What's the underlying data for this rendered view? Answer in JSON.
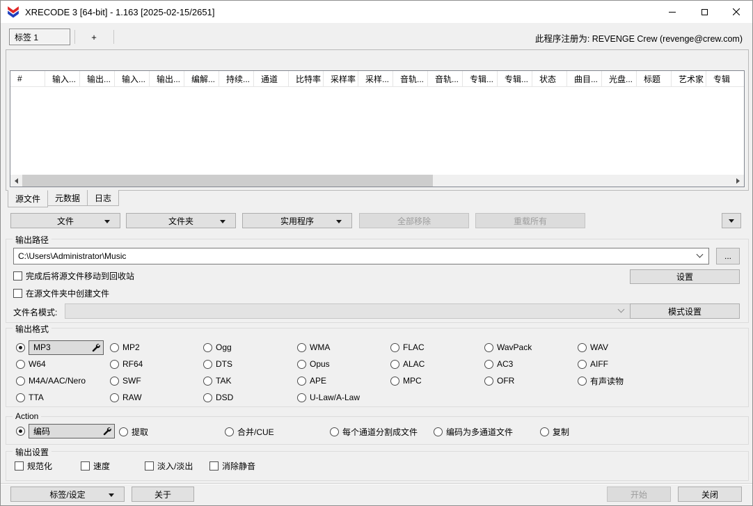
{
  "window": {
    "title": "XRECODE 3 [64-bit] - 1.163 [2025-02-15/2651]",
    "registration": "此程序注册为: REVENGE Crew (revenge@crew.com)"
  },
  "tab_strip": {
    "active_tab": "标签 1",
    "add_tab": "+"
  },
  "file_table": {
    "columns": [
      "#",
      "输入...",
      "输出...",
      "输入...",
      "输出...",
      "编解...",
      "持续...",
      "通道",
      "比特率",
      "采样率",
      "采样...",
      "音轨...",
      "音轨...",
      "专辑...",
      "专辑...",
      "状态",
      "曲目...",
      "光盘...",
      "标题",
      "艺术家",
      "专辑"
    ]
  },
  "view_tabs": {
    "sources": "源文件",
    "metadata": "元数据",
    "log": "日志"
  },
  "toolbar": {
    "file": "文件",
    "folder": "文件夹",
    "utilities": "实用程序",
    "remove_all": "全部移除",
    "reload_all": "重载所有"
  },
  "output_path": {
    "label": "输出路径",
    "value": "C:\\Users\\Administrator\\Music",
    "browse": "...",
    "settings_button": "设置",
    "recycle_checkbox": "完成后将源文件移动到回收站",
    "create_in_source_checkbox": "在源文件夹中创建文件",
    "filename_pattern_label": "文件名模式:",
    "pattern_value": "",
    "pattern_settings_button": "模式设置"
  },
  "output_format": {
    "label": "输出格式",
    "selected": "MP3",
    "items": [
      "MP3",
      "MP2",
      "Ogg",
      "WMA",
      "FLAC",
      "WavPack",
      "WAV",
      "W64",
      "RF64",
      "DTS",
      "Opus",
      "ALAC",
      "AC3",
      "AIFF",
      "M4A/AAC/Nero",
      "SWF",
      "TAK",
      "APE",
      "MPC",
      "OFR",
      "有声读物",
      "TTA",
      "RAW",
      "DSD",
      "U-Law/A-Law"
    ]
  },
  "action": {
    "label": "Action",
    "selected": "编码",
    "items": [
      "编码",
      "提取",
      "合并/CUE",
      "每个通道分割成文件",
      "编码为多通道文件",
      "复制"
    ]
  },
  "output_settings": {
    "label": "输出设置",
    "items": [
      "规范化",
      "速度",
      "淡入/淡出",
      "消除静音"
    ]
  },
  "footer": {
    "tags_settings": "标签/设定",
    "about": "关于",
    "start": "开始",
    "close": "关闭"
  }
}
